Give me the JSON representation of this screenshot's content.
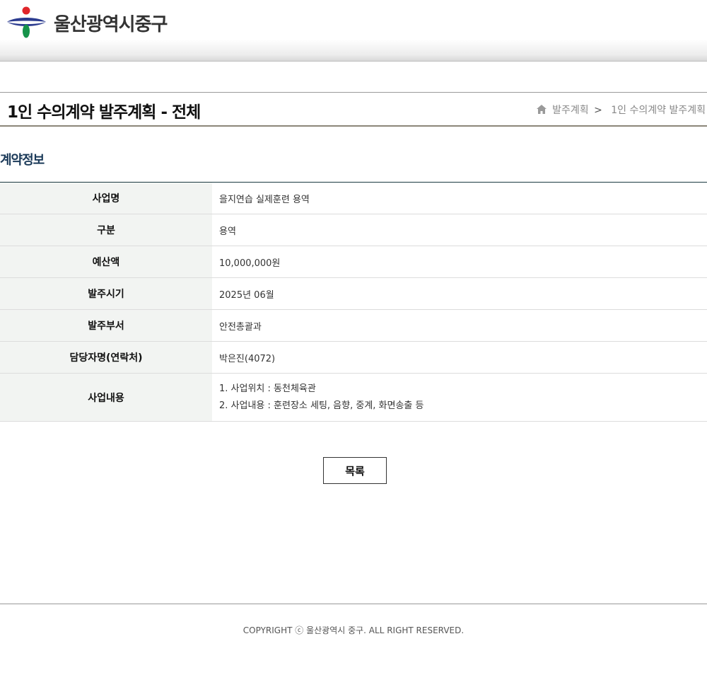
{
  "header": {
    "org_name": "울산광역시중구"
  },
  "page": {
    "title": "1인 수의계약 발주계획 - 전체"
  },
  "breadcrumb": {
    "items": [
      "발주계획",
      "1인 수의계약 발주계획"
    ],
    "separator": ">"
  },
  "section": {
    "title": "계약정보"
  },
  "contract": {
    "rows": [
      {
        "label": "사업명",
        "value": "을지연습 실제훈련 용역"
      },
      {
        "label": "구분",
        "value": "용역"
      },
      {
        "label": "예산액",
        "value": "10,000,000원"
      },
      {
        "label": "발주시기",
        "value": "2025년 06월"
      },
      {
        "label": "발주부서",
        "value": "안전총괄과"
      },
      {
        "label": "담당자명(연락처)",
        "value": "박은진(4072)"
      },
      {
        "label": "사업내용",
        "lines": [
          "1. 사업위치 : 동천체육관",
          "2. 사업내용 : 훈련장소 세팅, 음향, 중계, 화면송출 등"
        ]
      }
    ]
  },
  "actions": {
    "list_label": "목록"
  },
  "footer": {
    "copyright": "COPYRIGHT ⓒ 울산광역시 중구. ALL RIGHT RESERVED."
  },
  "colors": {
    "section_title": "#1b3a59",
    "header_bg": "#f2f4f2",
    "logo_red": "#e0262b",
    "logo_blue": "#2b3b8f",
    "logo_green": "#16934a"
  },
  "icons": {
    "home": "home-icon",
    "logo": "ulsan-junggu-logo"
  }
}
